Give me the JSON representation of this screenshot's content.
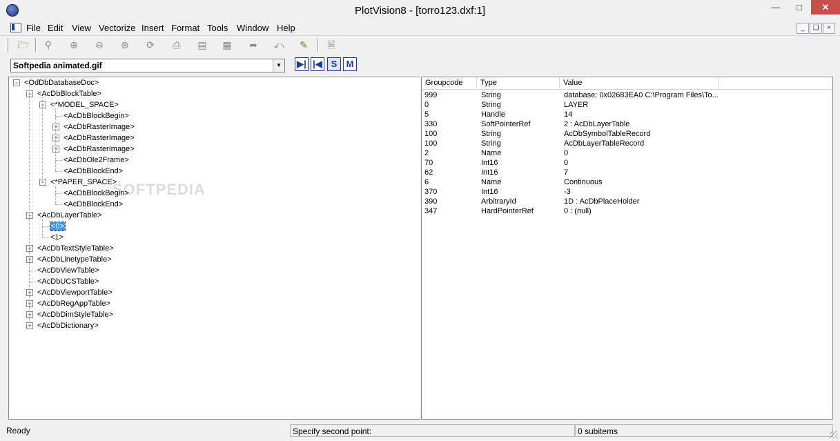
{
  "window": {
    "title": "PlotVision8 - [torro123.dxf:1]"
  },
  "menu": {
    "items": [
      "File",
      "Edit",
      "View",
      "Vectorize",
      "Insert",
      "Format",
      "Tools",
      "Window",
      "Help"
    ]
  },
  "toolbar": {
    "icons": [
      "open-folder-icon",
      "zoom-window-icon",
      "zoom-in-icon",
      "zoom-out-icon",
      "zoom-extents-icon",
      "orbit-icon",
      "print-icon",
      "print-preview-icon",
      "layers-icon",
      "redo-icon",
      "undo-icon",
      "properties-icon",
      "new-document-icon"
    ]
  },
  "combo": {
    "value": "Softpedia animated.gif"
  },
  "nav_buttons": [
    "▶|",
    "|◀",
    "S",
    "M"
  ],
  "watermark": "SOFTPEDIA",
  "tree": {
    "nodes": [
      {
        "label": "<OdDbDatabaseDoc>",
        "level": 0,
        "expander": "minus"
      },
      {
        "label": "<AcDbBlockTable>",
        "level": 1,
        "expander": "minus"
      },
      {
        "label": "<*MODEL_SPACE>",
        "level": 2,
        "expander": "minus"
      },
      {
        "label": "<AcDbBlockBegin>",
        "level": 3,
        "expander": "none"
      },
      {
        "label": "<AcDbRasterImage>",
        "level": 3,
        "expander": "plus"
      },
      {
        "label": "<AcDbRasterImage>",
        "level": 3,
        "expander": "plus"
      },
      {
        "label": "<AcDbRasterImage>",
        "level": 3,
        "expander": "plus"
      },
      {
        "label": "<AcDbOle2Frame>",
        "level": 3,
        "expander": "none"
      },
      {
        "label": "<AcDbBlockEnd>",
        "level": 3,
        "expander": "none"
      },
      {
        "label": "<*PAPER_SPACE>",
        "level": 2,
        "expander": "minus"
      },
      {
        "label": "<AcDbBlockBegin>",
        "level": 3,
        "expander": "none"
      },
      {
        "label": "<AcDbBlockEnd>",
        "level": 3,
        "expander": "none"
      },
      {
        "label": "<AcDbLayerTable>",
        "level": 1,
        "expander": "minus"
      },
      {
        "label": "<0>",
        "level": 2,
        "expander": "none",
        "selected": true
      },
      {
        "label": "<1>",
        "level": 2,
        "expander": "none"
      },
      {
        "label": "<AcDbTextStyleTable>",
        "level": 1,
        "expander": "plus"
      },
      {
        "label": "<AcDbLinetypeTable>",
        "level": 1,
        "expander": "plus"
      },
      {
        "label": "<AcDbViewTable>",
        "level": 1,
        "expander": "none"
      },
      {
        "label": "<AcDbUCSTable>",
        "level": 1,
        "expander": "none"
      },
      {
        "label": "<AcDbViewportTable>",
        "level": 1,
        "expander": "plus"
      },
      {
        "label": "<AcDbRegAppTable>",
        "level": 1,
        "expander": "plus"
      },
      {
        "label": "<AcDbDimStyleTable>",
        "level": 1,
        "expander": "plus"
      },
      {
        "label": "<AcDbDictionary>",
        "level": 1,
        "expander": "plus"
      }
    ]
  },
  "list": {
    "columns": [
      "Groupcode",
      "Type",
      "Value"
    ],
    "rows": [
      [
        "999",
        "String",
        "database: 0x02683EA0 C:\\Program Files\\To..."
      ],
      [
        "0",
        "String",
        "LAYER"
      ],
      [
        "5",
        "Handle",
        "14"
      ],
      [
        "330",
        "SoftPointerRef",
        "2 : AcDbLayerTable"
      ],
      [
        "100",
        "String",
        "AcDbSymbolTableRecord"
      ],
      [
        "100",
        "String",
        "AcDbLayerTableRecord"
      ],
      [
        "2",
        "Name",
        "0"
      ],
      [
        "70",
        "Int16",
        "0"
      ],
      [
        "62",
        "Int16",
        "7"
      ],
      [
        "6",
        "Name",
        "Continuous"
      ],
      [
        "370",
        "Int16",
        "-3"
      ],
      [
        "390",
        "ArbitraryId",
        "1D : AcDbPlaceHolder"
      ],
      [
        "347",
        "HardPointerRef",
        "0 : (null)"
      ]
    ]
  },
  "status": {
    "left": "Ready",
    "middle": "Specify second point:",
    "right": "0 subitems"
  }
}
